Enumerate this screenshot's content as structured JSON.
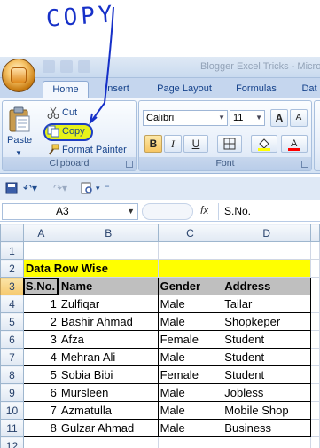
{
  "annotation": {
    "text": "COPY"
  },
  "window": {
    "title": "Blogger Excel Tricks - Microsoft Excel"
  },
  "tabs": [
    {
      "label": "Home",
      "active": true
    },
    {
      "label": "Insert",
      "active": false
    },
    {
      "label": "Page Layout",
      "active": false
    },
    {
      "label": "Formulas",
      "active": false
    },
    {
      "label": "Dat",
      "active": false
    }
  ],
  "ribbon": {
    "clipboard": {
      "title": "Clipboard",
      "paste_label": "Paste",
      "cut_label": "Cut",
      "copy_label": "Copy",
      "format_painter_label": "Format Painter"
    },
    "font": {
      "title": "Font",
      "font_name": "Calibri",
      "font_size": "11",
      "bold": "B",
      "italic": "I",
      "underline": "U",
      "grow": "A",
      "shrink": "A",
      "fill_color": "#ffff00",
      "font_color": "#ff0000"
    }
  },
  "formula_bar": {
    "name_box": "A3",
    "fx": "fx",
    "value": "S.No."
  },
  "sheet": {
    "columns": [
      "A",
      "B",
      "C",
      "D"
    ],
    "rows": [
      "1",
      "2",
      "3",
      "4",
      "5",
      "6",
      "7",
      "8",
      "9",
      "10",
      "11",
      "12"
    ],
    "title_cell": "Data Row Wise",
    "headers": [
      "S.No.",
      "Name",
      "Gender",
      "Address"
    ],
    "data": [
      [
        "1",
        "Zulfiqar",
        "Male",
        "Tailar"
      ],
      [
        "2",
        "Bashir Ahmad",
        "Male",
        "Shopkeper"
      ],
      [
        "3",
        "Afza",
        "Female",
        "Student"
      ],
      [
        "4",
        "Mehran Ali",
        "Male",
        "Student"
      ],
      [
        "5",
        "Sobia Bibi",
        "Female",
        "Student"
      ],
      [
        "6",
        "Mursleen",
        "Male",
        "Jobless"
      ],
      [
        "7",
        "Azmatulla",
        "Male",
        "Mobile Shop"
      ],
      [
        "8",
        "Gulzar Ahmad",
        "Male",
        "Business"
      ]
    ]
  }
}
